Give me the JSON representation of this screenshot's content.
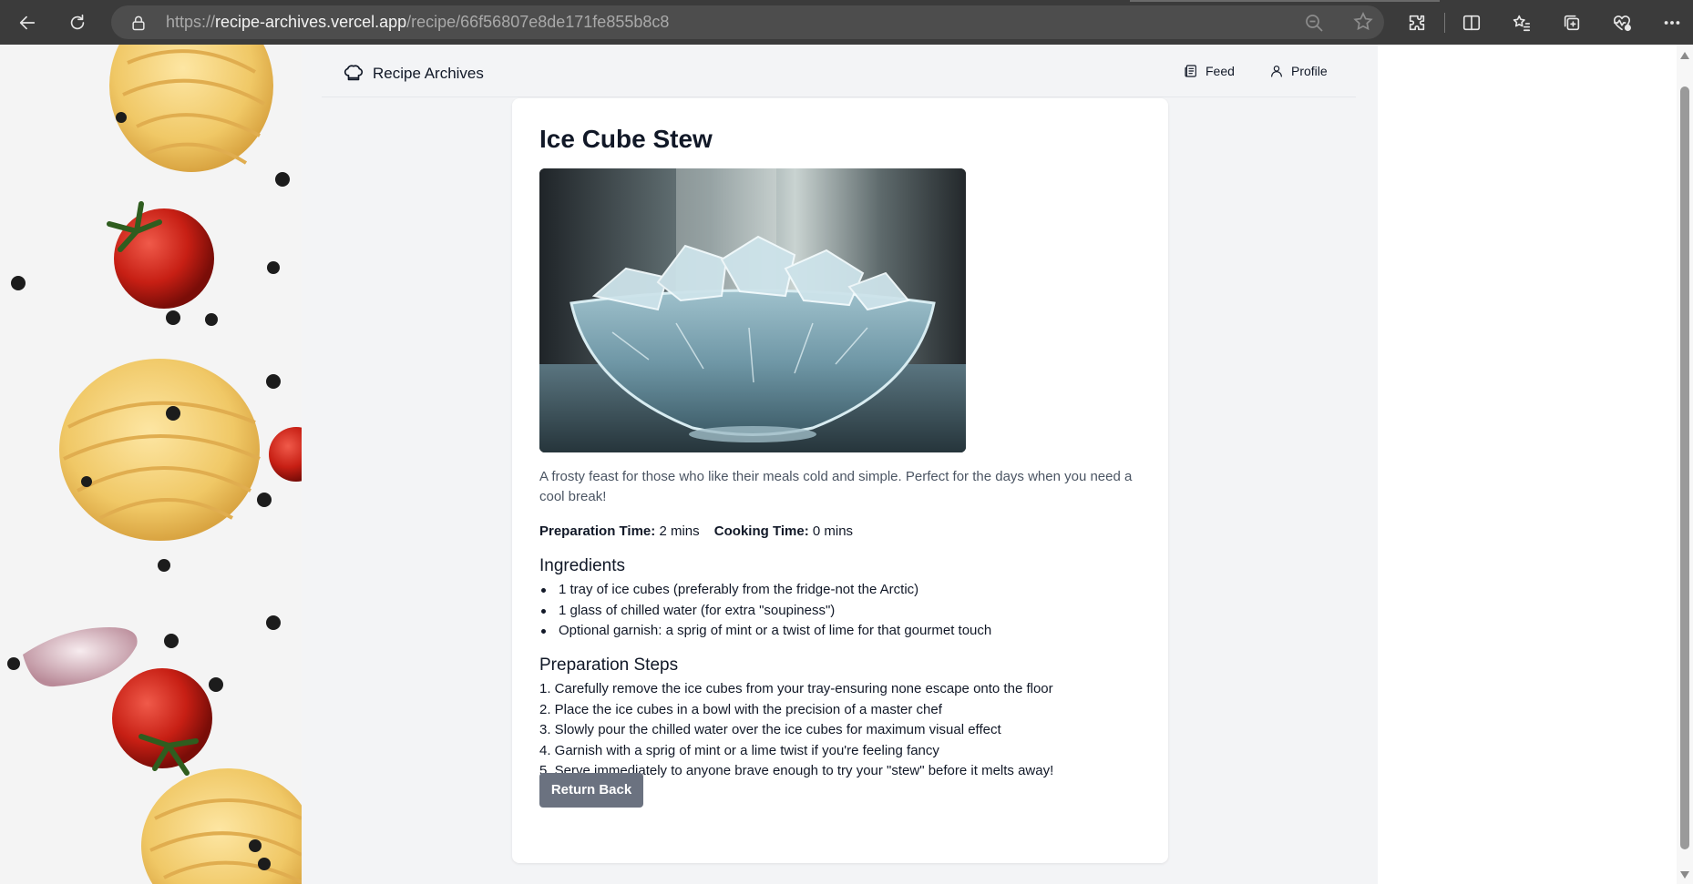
{
  "browser": {
    "url_prefix": "https://",
    "url_host": "recipe-archives.vercel.app",
    "url_path": "/recipe/66f56807e8de171fe855b8c8"
  },
  "nav": {
    "brand": "Recipe Archives",
    "links": [
      {
        "label": "Feed",
        "icon": "newspaper-icon"
      },
      {
        "label": "Profile",
        "icon": "user-icon"
      }
    ]
  },
  "recipe": {
    "title": "Ice Cube Stew",
    "image_alt": "bowl of ice cubes",
    "description": "A frosty feast for those who like their meals cold and simple. Perfect for the days when you need a cool break!",
    "prep_label": "Preparation Time:",
    "prep_value": "2 mins",
    "cook_label": "Cooking Time:",
    "cook_value": "0 mins",
    "ingredients_heading": "Ingredients",
    "ingredients": [
      "1 tray of ice cubes (preferably from the fridge-not the Arctic)",
      "1 glass of chilled water (for extra \"soupiness\")",
      "Optional garnish: a sprig of mint or a twist of lime for that gourmet touch"
    ],
    "steps_heading": "Preparation Steps",
    "steps": [
      "1. Carefully remove the ice cubes from your tray-ensuring none escape onto the floor",
      "2. Place the ice cubes in a bowl with the precision of a master chef",
      "3. Slowly pour the chilled water over the ice cubes for maximum visual effect",
      "4. Garnish with a sprig of mint or a lime twist if you're feeling fancy",
      "5. Serve immediately to anyone brave enough to try your \"stew\" before it melts away!"
    ],
    "return_label": "Return Back"
  },
  "colors": {
    "chrome": "#3b3b3b",
    "page_bg": "#f3f4f6",
    "button": "#6b7280",
    "text": "#111827",
    "muted_text": "#4b5563"
  }
}
